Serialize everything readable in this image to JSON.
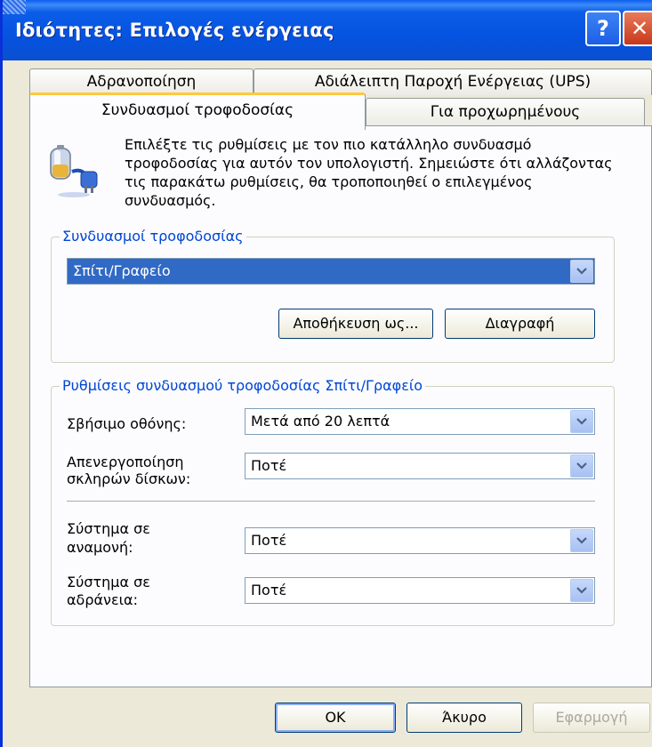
{
  "window": {
    "title": "Ιδιότητες: Επιλογές ενέργειας",
    "help_symbol": "?",
    "close_symbol": "✕"
  },
  "tabs": [
    {
      "label": "Αδρανοποίηση"
    },
    {
      "label": "Αδιάλειπτη Παροχή Ενέργειας (UPS)"
    },
    {
      "label": "Συνδυασμοί τροφοδοσίας"
    },
    {
      "label": "Για προχωρημένους"
    }
  ],
  "description": "Επιλέξτε τις ρυθμίσεις με τον πιο κατάλληλο συνδυασμό τροφοδοσίας για αυτόν τον υπολογιστή. Σημειώστε ότι αλλάζοντας τις παρακάτω ρυθμίσεις, θα τροποποιηθεί ο επιλεγμένος συνδυασμός.",
  "schemes": {
    "group_title": "Συνδυασμοί τροφοδοσίας",
    "selected": "Σπίτι/Γραφείο",
    "save_as_label": "Αποθήκευση ως...",
    "delete_label": "Διαγραφή"
  },
  "settings": {
    "group_title": "Ρυθμίσεις συνδυασμού τροφοδοσίας Σπίτι/Γραφείο",
    "monitor_label": "Σβήσιμο οθόνης:",
    "monitor_value": "Μετά από 20 λεπτά",
    "disks_label_1": "Απενεργοποίηση",
    "disks_label_2": "σκληρών δίσκων:",
    "disks_value": "Ποτέ",
    "standby_label_1": "Σύστημα σε",
    "standby_label_2": "αναμονή:",
    "standby_value": "Ποτέ",
    "hibernate_label_1": "Σύστημα σε",
    "hibernate_label_2": "αδράνεια:",
    "hibernate_value": "Ποτέ"
  },
  "footer": {
    "ok_label": "OK",
    "cancel_label": "Άκυρο",
    "apply_label": "Εφαρμογή"
  }
}
